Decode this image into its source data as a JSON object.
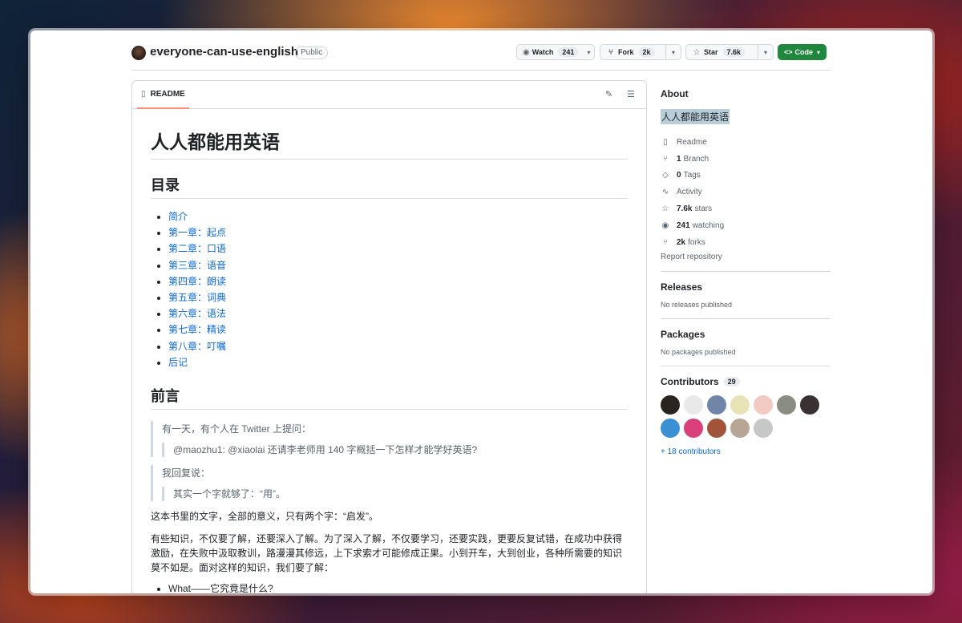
{
  "repo": {
    "name": "everyone-can-use-english",
    "visibility": "Public"
  },
  "actions": {
    "watch_label": "Watch",
    "watch_count": "241",
    "fork_label": "Fork",
    "fork_count": "2k",
    "star_label": "Star",
    "star_count": "7.6k",
    "code_label": "Code"
  },
  "readme": {
    "tab_label": "README",
    "title": "人人都能用英语",
    "toc_heading": "目录",
    "toc": [
      "简介",
      "第一章：起点",
      "第二章：口语",
      "第三章：语音",
      "第四章：朗读",
      "第五章：词典",
      "第六章：语法",
      "第七章：精读",
      "第八章：叮嘱",
      "后记"
    ],
    "preface_heading": "前言",
    "quote1": "有一天，有个人在 Twitter 上提问：",
    "quote1_inner": "@maozhu1: @xiaolai 还请李老师用 140 字概括一下怎样才能学好英语?",
    "quote2": "我回复说：",
    "quote2_inner": "其实一个字就够了：“用”。",
    "para1": "这本书里的文字，全部的意义，只有两个字：“启发”。",
    "para2": "有些知识，不仅要了解，还要深入了解。为了深入了解，不仅要学习，还要实践，更要反复试错，在成功中获得激励，在失败中汲取教训，路漫漫其修远，上下求索才可能修成正果。小到开车，大到创业，各种所需要的知识莫不如是。面对这样的知识，我们要了解：",
    "list_item1": "What——它究竟是什么?"
  },
  "about": {
    "heading": "About",
    "description": "人人都能用英语",
    "readme": "Readme",
    "branch_num": "1",
    "branch_label": "Branch",
    "tags_num": "0",
    "tags_label": "Tags",
    "activity": "Activity",
    "stars_num": "7.6k",
    "stars_label": "stars",
    "watching_num": "241",
    "watching_label": "watching",
    "forks_num": "2k",
    "forks_label": "forks",
    "report": "Report repository"
  },
  "releases": {
    "heading": "Releases",
    "text": "No releases published"
  },
  "packages": {
    "heading": "Packages",
    "text": "No packages published"
  },
  "contributors": {
    "heading": "Contributors",
    "count": "29",
    "more": "+ 18 contributors",
    "avatar_colors": [
      "#2a2320",
      "#e9e9ea",
      "#6f86a8",
      "#e8e3b4",
      "#f2c9c3",
      "#8a8d82",
      "#3a3232",
      "#3b8fd3",
      "#d8417a",
      "#a1543a",
      "#b8a595",
      "#c6c8c8"
    ]
  },
  "colors": {
    "link": "#0969da",
    "code_button": "#1f883d",
    "tab_underline": "#fd8c73"
  },
  "icons": [
    "eye-icon",
    "repo-forked-icon",
    "star-icon",
    "code-icon",
    "book-icon",
    "pencil-icon",
    "list-icon",
    "git-branch-icon",
    "tag-icon",
    "pulse-icon"
  ]
}
